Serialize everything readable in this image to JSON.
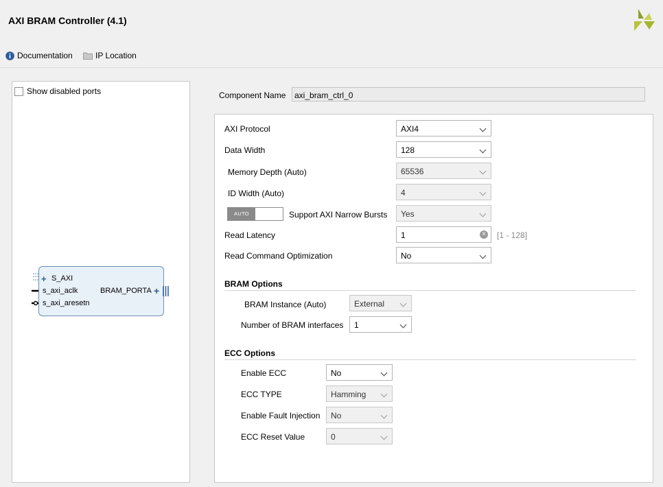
{
  "header": {
    "title": "AXI BRAM Controller (4.1)",
    "documentation_label": "Documentation",
    "ip_location_label": "IP Location"
  },
  "symbol_panel": {
    "show_disabled_label": "Show disabled ports",
    "ports_left": [
      "S_AXI",
      "s_axi_aclk",
      "s_axi_aresetn"
    ],
    "port_right": "BRAM_PORTA"
  },
  "component": {
    "label": "Component Name",
    "value": "axi_bram_ctrl_0"
  },
  "params": {
    "axi_protocol": {
      "label": "AXI Protocol",
      "value": "AXI4"
    },
    "data_width": {
      "label": "Data Width",
      "value": "128"
    },
    "memory_depth": {
      "label": "Memory Depth (Auto)",
      "value": "65536"
    },
    "id_width": {
      "label": "ID Width (Auto)",
      "value": "4"
    },
    "narrow_bursts": {
      "label": "Support AXI Narrow Bursts",
      "value": "Yes",
      "toggle": "AUTO"
    },
    "read_latency": {
      "label": "Read Latency",
      "value": "1",
      "range": "[1 - 128]"
    },
    "read_cmd_opt": {
      "label": "Read Command Optimization",
      "value": "No"
    }
  },
  "bram_options": {
    "title": "BRAM Options",
    "instance": {
      "label": "BRAM Instance (Auto)",
      "value": "External"
    },
    "num_interfaces": {
      "label": "Number of BRAM interfaces",
      "value": "1"
    }
  },
  "ecc_options": {
    "title": "ECC Options",
    "enable_ecc": {
      "label": "Enable ECC",
      "value": "No"
    },
    "ecc_type": {
      "label": "ECC TYPE",
      "value": "Hamming"
    },
    "fault_injection": {
      "label": "Enable Fault Injection",
      "value": "No"
    },
    "reset_value": {
      "label": "ECC Reset Value",
      "value": "0"
    }
  },
  "colors": {
    "logo_green": "#a4b62c",
    "block_fill": "#e8f0f8",
    "block_border": "#6b8fb5"
  }
}
